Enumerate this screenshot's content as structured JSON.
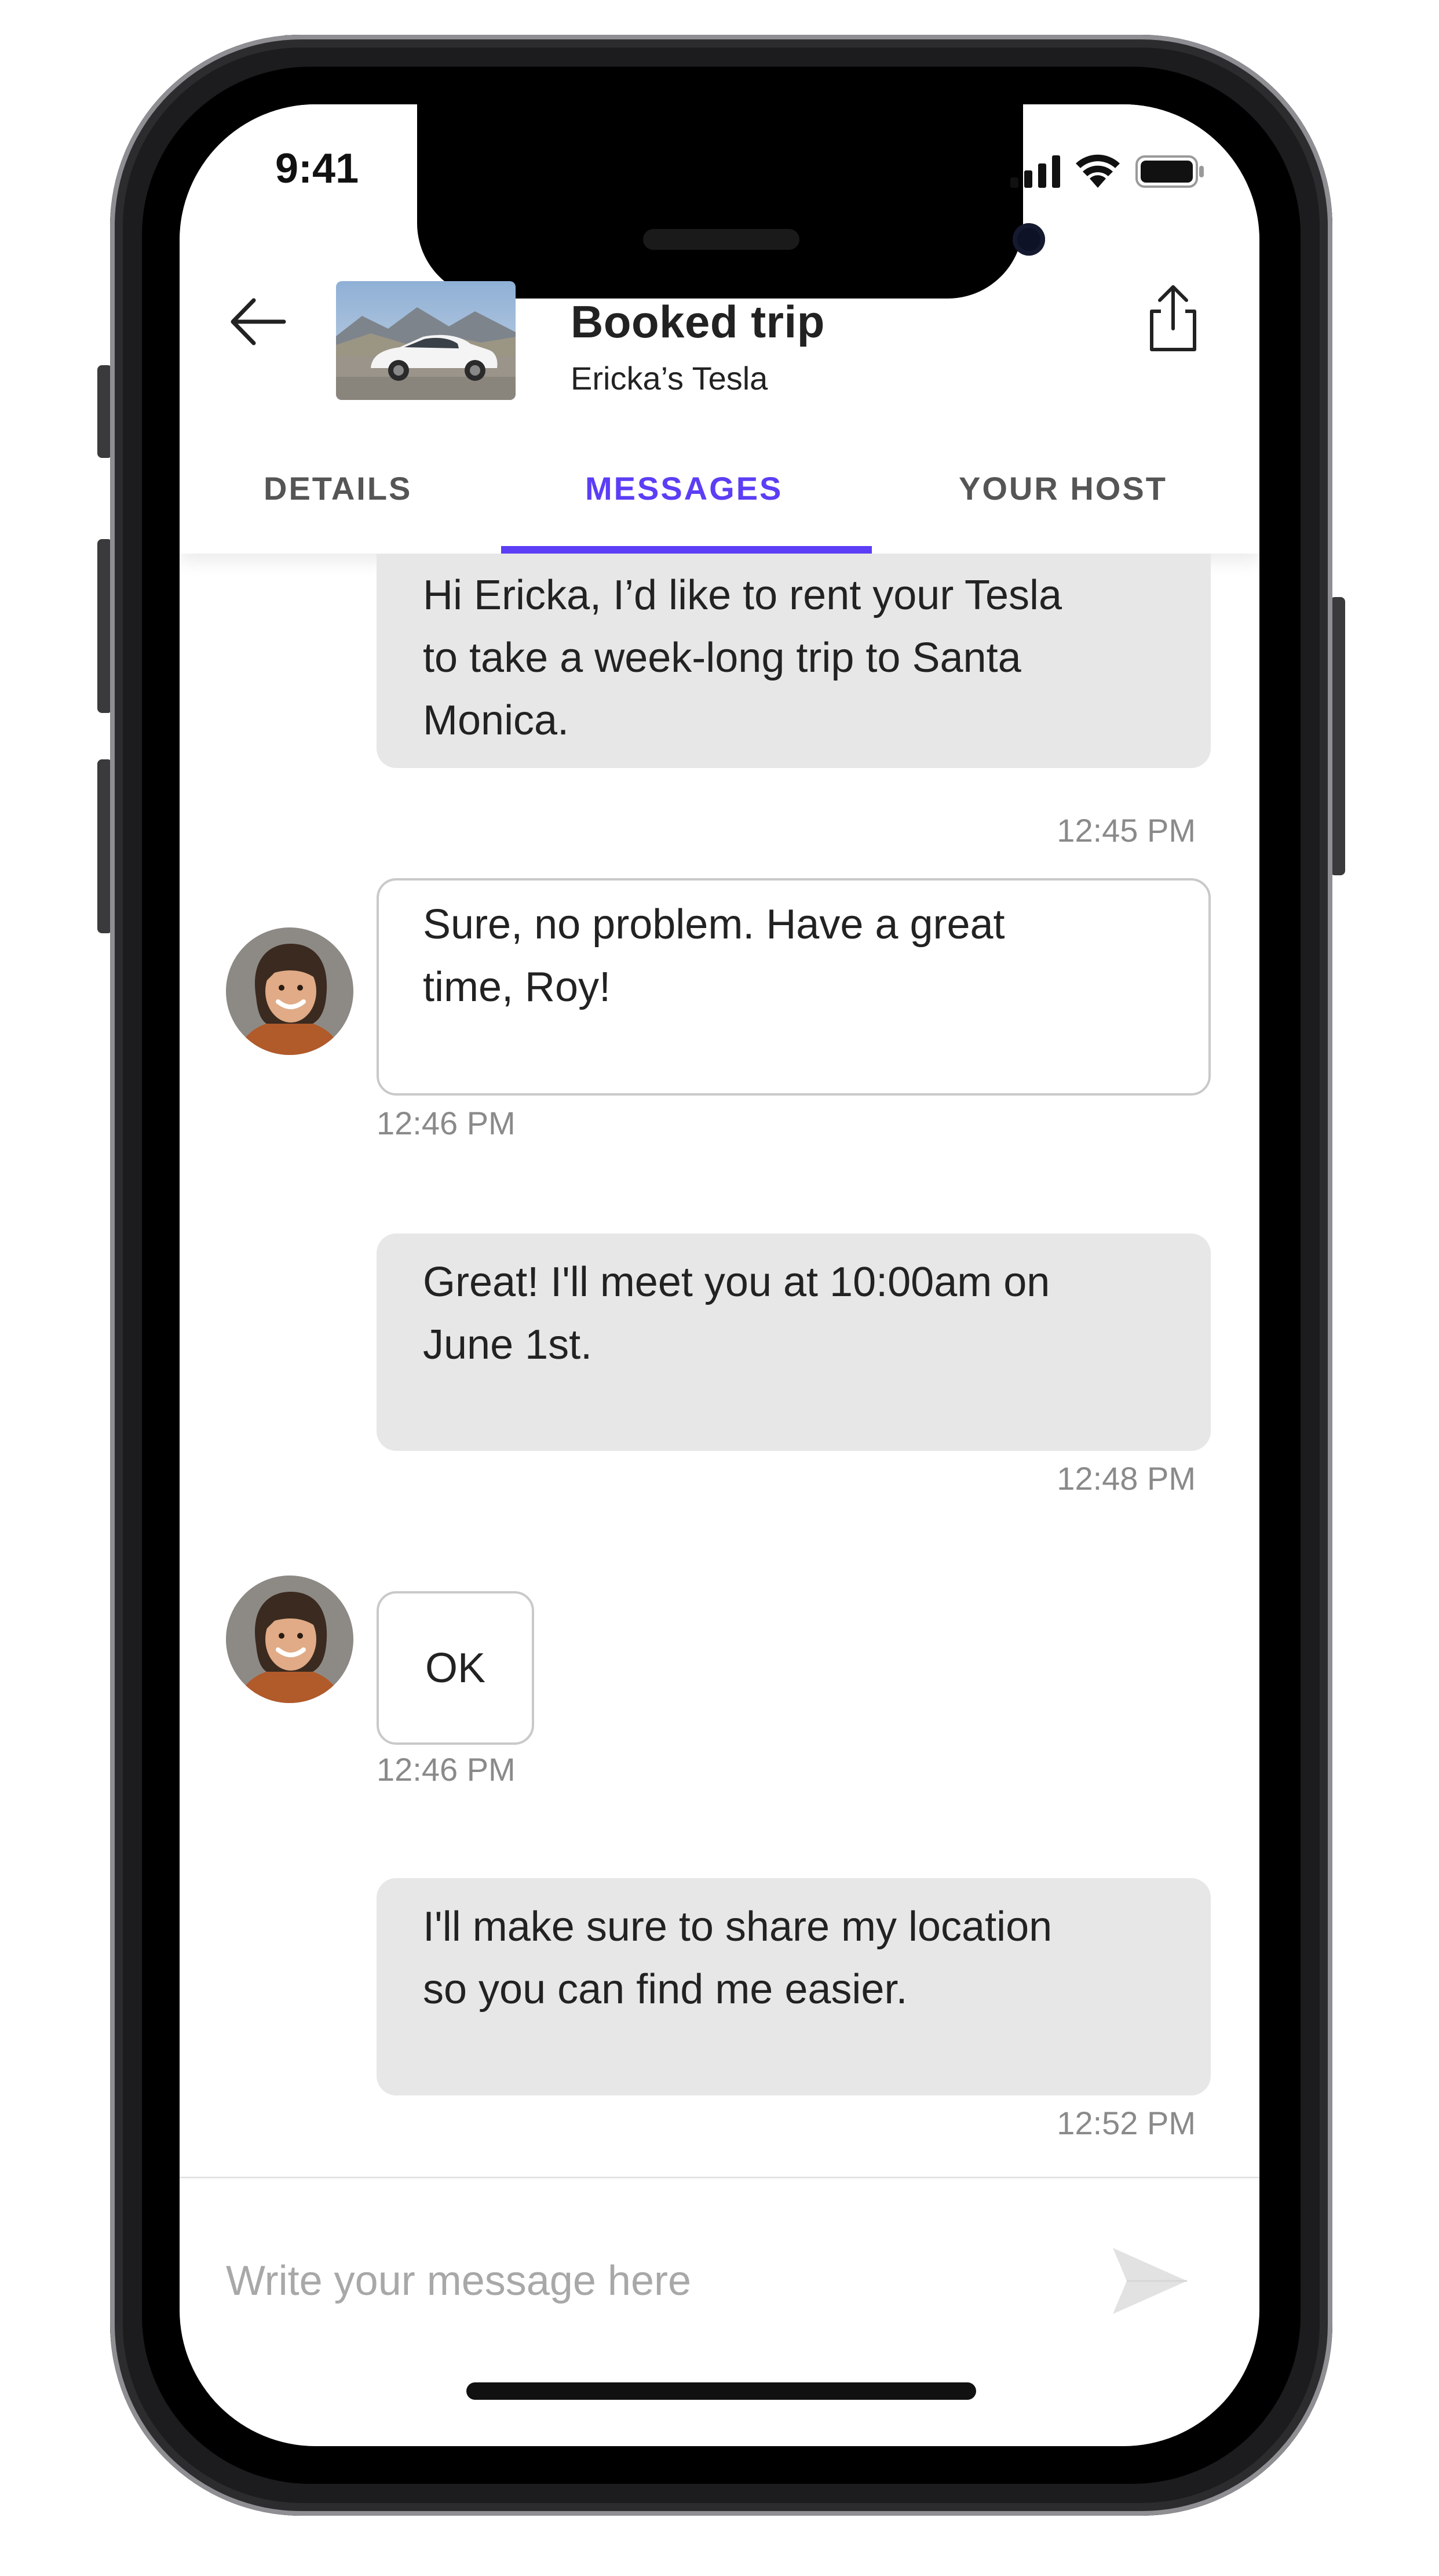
{
  "status_bar": {
    "time": "9:41"
  },
  "header": {
    "title": "Booked trip",
    "subtitle": "Ericka’s Tesla",
    "icons": {
      "back": "arrow-left-icon",
      "share": "share-icon",
      "car": "tesla-car-thumbnail"
    }
  },
  "tabs": [
    {
      "label": "DETAILS",
      "active": false
    },
    {
      "label": "MESSAGES",
      "active": true
    },
    {
      "label": "YOUR HOST",
      "active": false
    }
  ],
  "messages": [
    {
      "direction": "out",
      "lines": [
        "Hi Ericka, I’d like to rent your Tesla",
        "to take a week-long trip to Santa",
        "Monica."
      ],
      "time": "12:45 PM"
    },
    {
      "direction": "in",
      "lines": [
        "Sure, no problem. Have a great",
        "time, Roy!"
      ],
      "time": "12:46 PM"
    },
    {
      "direction": "out",
      "lines": [
        "Great! I'll meet you at 10:00am on",
        "June 1st."
      ],
      "time": "12:48 PM"
    },
    {
      "direction": "in",
      "lines": [
        "OK"
      ],
      "time": "12:46 PM"
    },
    {
      "direction": "out",
      "lines": [
        "I'll make sure to share my location",
        "so you can find me easier."
      ],
      "time": "12:52 PM"
    }
  ],
  "composer": {
    "placeholder": "Write your message here",
    "send_icon": "send-icon"
  },
  "colors": {
    "accent": "#5b3ef5",
    "outgoing_bubble": "#e7e7e7",
    "timestamp": "#8a8a8a"
  }
}
